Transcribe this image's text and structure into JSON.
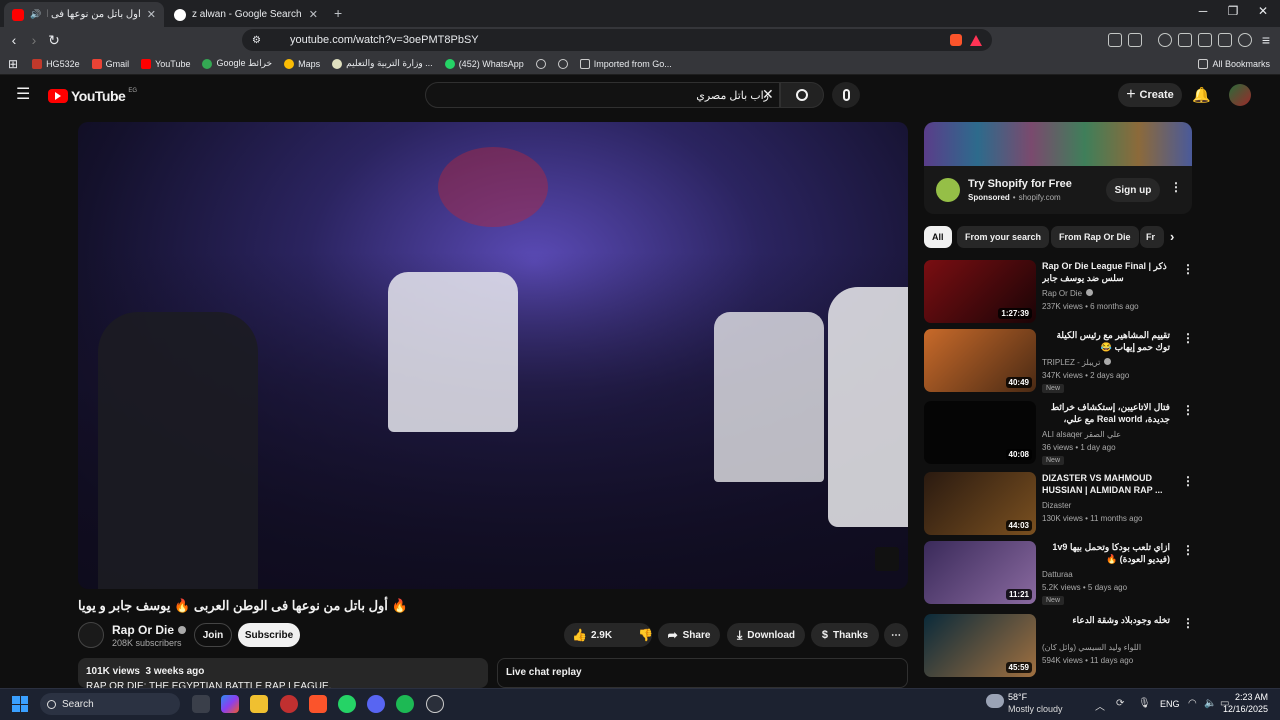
{
  "browser": {
    "tabs": [
      {
        "title": "أول باتل من نوعها فى الوطن ال...",
        "active": true
      },
      {
        "title": "z alwan - Google Search",
        "active": false
      }
    ],
    "new_tab": "+",
    "url": "youtube.com/watch?v=3oePMT8PbSY",
    "bookmarks": [
      "HG532e",
      "Gmail",
      "YouTube",
      "Google خرائط",
      "Maps",
      "وزارة التربية والتعليم ...",
      "(452) WhatsApp",
      "Imported from Go...",
      "All Bookmarks"
    ]
  },
  "youtube": {
    "logo": "YouTube",
    "country": "EG",
    "search_value": "راب باتل مصري",
    "create_label": "Create"
  },
  "video": {
    "title": "🔥 أول باتل من نوعها فى الوطن العربى 🔥 يوسف جابر و يويا",
    "channel": "Rap Or Die",
    "subscribers": "208K subscribers",
    "join_label": "Join",
    "subscribe_label": "Subscribe",
    "likes": "2.9K",
    "share_label": "Share",
    "download_label": "Download",
    "thanks_label": "Thanks",
    "views_line": "101K views  3 weeks ago",
    "desc_line": "RAP OR DIE: THE EGYPTIAN BATTLE RAP LEAGUE.",
    "live_chat": "Live chat replay"
  },
  "ad": {
    "title": "Try Shopify for Free",
    "sponsored": "Sponsored",
    "domain": "shopify.com",
    "cta": "Sign up"
  },
  "chips": [
    "All",
    "From your search",
    "From Rap Or Die",
    "Fr"
  ],
  "recommendations": [
    {
      "title": "Rap Or Die League Final | ذكر سلس ضد يوسف جابر",
      "rtl": false,
      "channel": "Rap Or Die",
      "verified": true,
      "meta": "237K views • 6 months ago",
      "duration": "1:27:39",
      "badge": "",
      "colors": [
        "#7a0e12",
        "#1a0406"
      ]
    },
    {
      "title": "تقييم المشاهير مع رئيس الكيلة توك حمو إيهاب 😂",
      "rtl": true,
      "channel": "TRIPLEZ - تريبلز",
      "verified": true,
      "meta": "347K views • 2 days ago",
      "duration": "40:49",
      "badge": "New",
      "colors": [
        "#c86a2a",
        "#4a2a14"
      ]
    },
    {
      "title": "فتال الاتاعيبن، إستكشاف خرائط جديدة، Real world مع علي، والمزيد مع لجنة...",
      "rtl": true,
      "channel": "ALI alsaqer علي الصقر",
      "verified": false,
      "meta": "36 views • 1 day ago",
      "duration": "40:08",
      "badge": "New",
      "colors": [
        "#050505",
        "#050505"
      ]
    },
    {
      "title": "DIZASTER VS MAHMOUD HUSSIAN | ALMIDAN RAP ...",
      "rtl": false,
      "channel": "Dizaster",
      "verified": false,
      "meta": "130K views • 11 months ago",
      "duration": "44:03",
      "badge": "",
      "colors": [
        "#2a1a10",
        "#7a5020"
      ]
    },
    {
      "title": "ازاي تلعب بودكا وتحمل بيها 1v9 (فيديو العودة) 🔥",
      "rtl": true,
      "channel": "Datturaa",
      "verified": false,
      "meta": "5.2K views • 5 days ago",
      "duration": "11:21",
      "badge": "New",
      "colors": [
        "#3a2a5a",
        "#8a6aa0"
      ]
    },
    {
      "title": "تخله وجودبلاد وشقة الدعاء",
      "rtl": true,
      "channel": "اللواء وليد السيسي (وائل كان)",
      "verified": false,
      "meta": "594K views • 11 days ago",
      "duration": "45:59",
      "badge": "",
      "colors": [
        "#0a2a3a",
        "#a07040"
      ]
    }
  ],
  "taskbar": {
    "search": "Search",
    "weather_temp": "58°F",
    "weather_desc": "Mostly cloudy",
    "lang": "ENG",
    "time": "2:23 AM",
    "date": "12/16/2025"
  }
}
